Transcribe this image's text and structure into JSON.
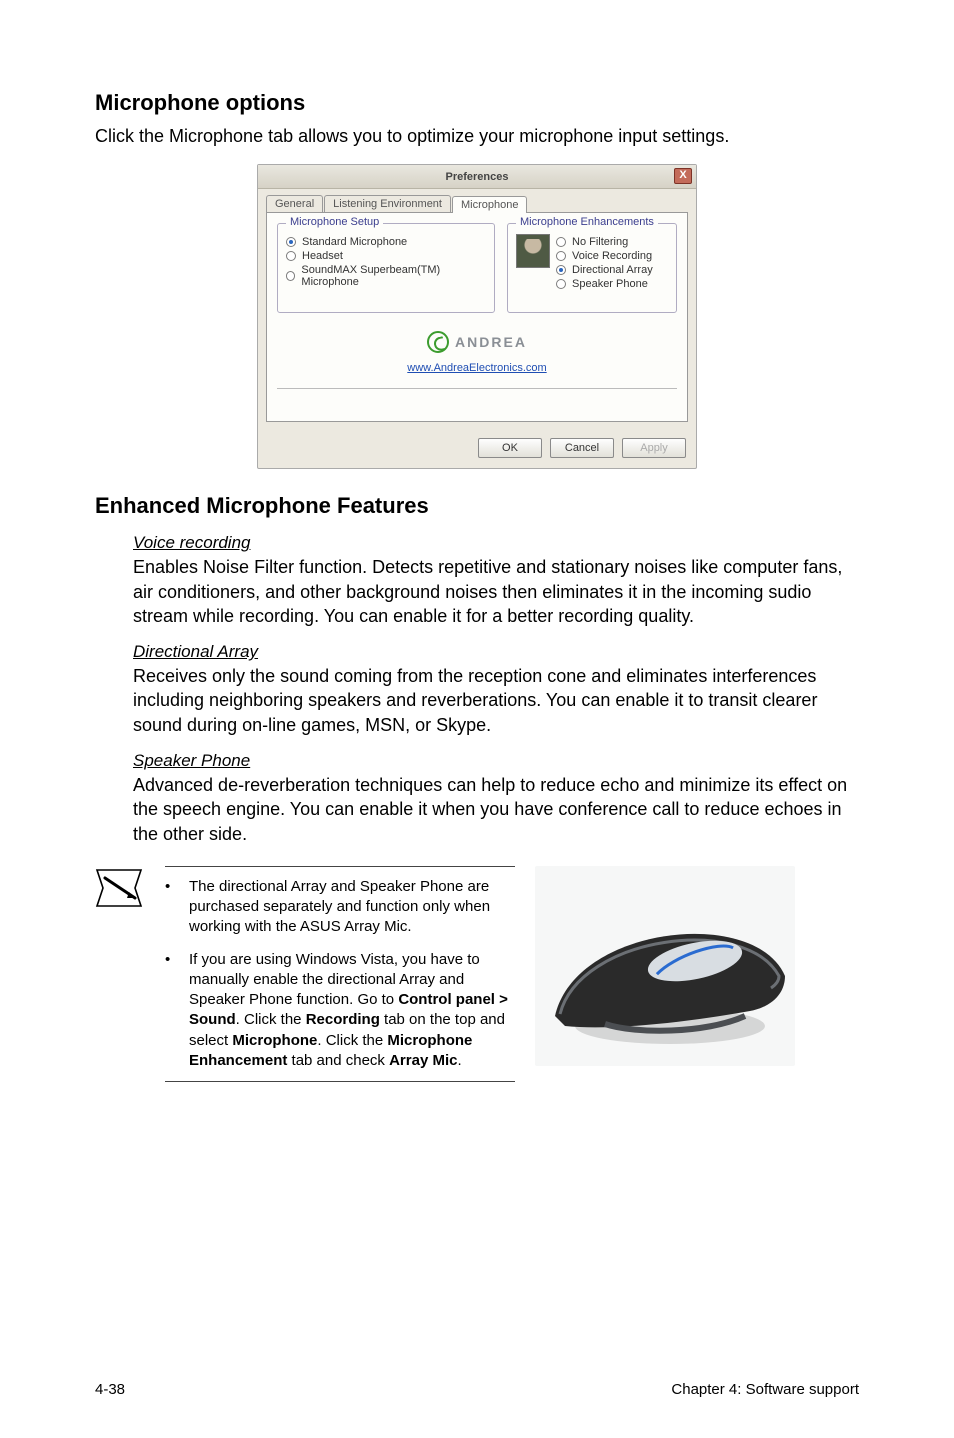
{
  "section1": {
    "title": "Microphone options",
    "lead": "Click the Microphone tab allows you to optimize your microphone input settings."
  },
  "dialog": {
    "title": "Preferences",
    "close": "X",
    "tabs": {
      "general": "General",
      "listening": "Listening Environment",
      "microphone": "Microphone"
    },
    "group_left_title": "Microphone Setup",
    "left_opts": {
      "o1": "Standard Microphone",
      "o2": "Headset",
      "o3": "SoundMAX Superbeam(TM) Microphone"
    },
    "group_right_title": "Microphone Enhancements",
    "right_opts": {
      "r1": "No Filtering",
      "r2": "Voice Recording",
      "r3": "Directional Array",
      "r4": "Speaker Phone"
    },
    "andrea_text": "ANDREA",
    "andrea_link": "www.AndreaElectronics.com",
    "ok": "OK",
    "cancel": "Cancel",
    "apply": "Apply"
  },
  "section2": {
    "title": "Enhanced Microphone Features",
    "voice_h": "Voice recording",
    "voice_p": "Enables Noise Filter function. Detects repetitive and stationary noises like computer fans, air conditioners, and other background noises then eliminates it in the incoming sudio stream while recording. You can enable it for a better recording quality.",
    "dir_h": "Directional Array",
    "dir_p": "Receives only the sound coming from the reception cone and eliminates interferences including neighboring speakers and reverberations. You can enable it to transit clearer sound during on-line games, MSN, or Skype.",
    "sp_h": "Speaker Phone",
    "sp_p": "Advanced de-reverberation techniques can help to reduce echo and minimize its effect on the speech engine. You can enable it when you have conference call to reduce echoes in the other side."
  },
  "note": {
    "b1": "The directional Array and Speaker Phone are purchased separately and function only when working with the ASUS Array Mic.",
    "b2_part1": "If you are using Windows Vista, you have to manually enable the directional Array and Speaker Phone function. Go to ",
    "b2_bold1": "Control panel > Sound",
    "b2_part2": ". Click the ",
    "b2_bold2": "Recording",
    "b2_part3": " tab on the top and select ",
    "b2_bold3": "Microphone",
    "b2_part4": ". Click the ",
    "b2_bold4": "Microphone Enhancement",
    "b2_part5": " tab and check ",
    "b2_bold5": "Array Mic",
    "b2_part6": "."
  },
  "footer": {
    "left": "4-38",
    "right": "Chapter 4: Software support"
  }
}
